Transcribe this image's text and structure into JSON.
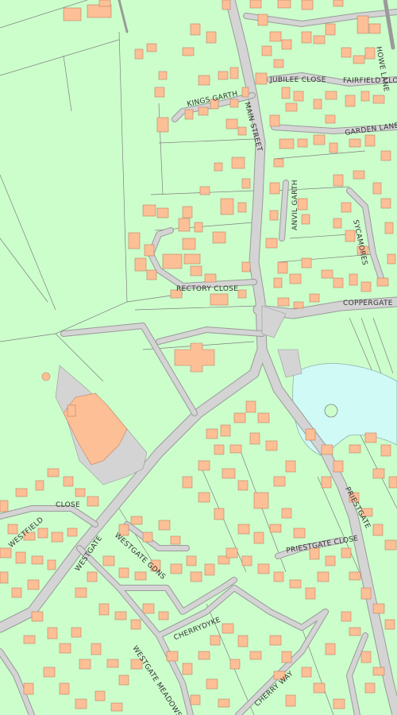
{
  "map": {
    "colors": {
      "background": "#ccfecc",
      "road": "#d4d4d4",
      "road_edge": "#9a9a9a",
      "building": "#fcbf96",
      "building_edge": "#c08060",
      "water": "#cffaf5",
      "boundary": "#7f7f7f"
    },
    "labels": {
      "kings_garth": "KINGS GARTH",
      "main_street": "MAIN STREET",
      "jubilee_close": "JUBILEE CLOSE",
      "fairfield_close": "FAIRFIELD CLOSE",
      "howe_lane": "HOWE LANE",
      "garden_lane": "GARDEN LANE",
      "anvil_garth": "ANVIL GARTH",
      "sycamores": "SYCAMORES",
      "rectory_close": "RECTORY CLOSE",
      "coppergate": "COPPERGATE",
      "westfield_close_a": "WESTFIELD",
      "westfield_close_b": "CLOSE",
      "westgate": "WESTGATE",
      "westgate_gdns": "WESTGATE GDNS",
      "priestgate": "PRIESTGATE",
      "priestgate_close": "PRIESTGATE CLOSE",
      "cherrydyke": "CHERRYDYKE",
      "westgate_meadows": "WESTGATE MEADOWS",
      "cherry_way": "CHERRY WAY"
    }
  }
}
